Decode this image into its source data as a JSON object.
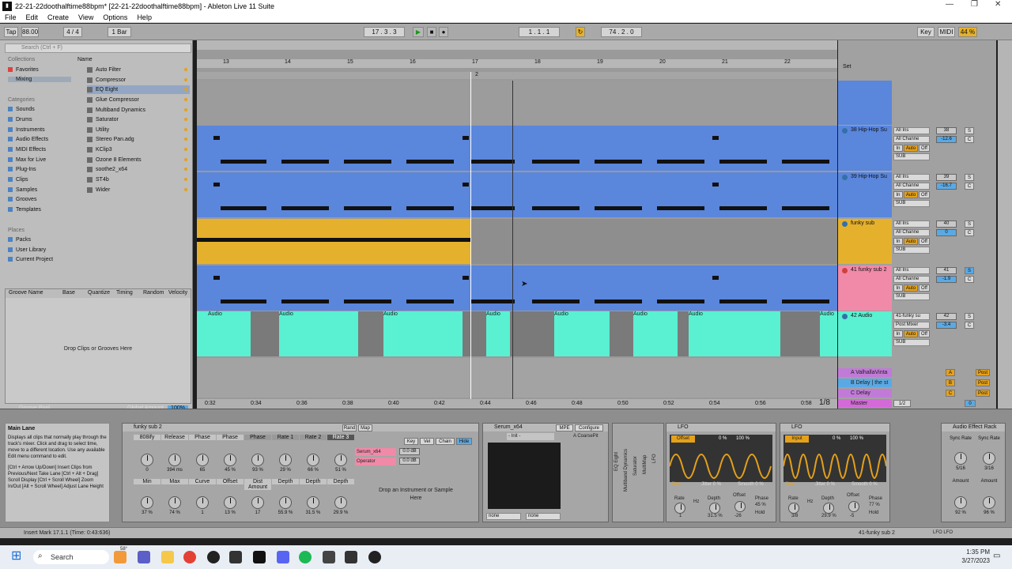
{
  "window": {
    "title": "22-21-22doothalftime88bpm* [22-21-22doothalftime88bpm] - Ableton Live 11 Suite"
  },
  "menu": [
    "File",
    "Edit",
    "Create",
    "View",
    "Options",
    "Help"
  ],
  "control": {
    "tap": "Tap",
    "tempo": "88.00",
    "sig": "4 / 4",
    "quant": "1 Bar",
    "pos": "17 . 3 . 3",
    "loop_start": "1 . 1 . 1",
    "loop_len": "74 . 2 . 0",
    "key": "Key",
    "midi": "MIDI",
    "cpu": "44 %"
  },
  "browser": {
    "search_placeholder": "Search (Ctrl + F)",
    "collections_head": "Collections",
    "collections": [
      "Favorites",
      "Mixing"
    ],
    "categories_head": "Categories",
    "categories": [
      "Sounds",
      "Drums",
      "Instruments",
      "Audio Effects",
      "MIDI Effects",
      "Max for Live",
      "Plug-Ins",
      "Clips",
      "Samples",
      "Grooves",
      "Templates"
    ],
    "places_head": "Places",
    "places": [
      "Packs",
      "User Library",
      "Current Project"
    ],
    "name_head": "Name",
    "items": [
      "Auto Filter",
      "Compressor",
      "EQ Eight",
      "Glue Compressor",
      "Multiband Dynamics",
      "Saturator",
      "Utility",
      "Stereo Pan.adg",
      "KClip3",
      "Ozone 8 Elements",
      "soothe2_x64",
      "ST4b",
      "Wider"
    ]
  },
  "groove": {
    "cols": [
      "Groove Name",
      "Base",
      "Quantize",
      "Timing",
      "Random",
      "Velocity"
    ],
    "hint": "Drop Clips or Grooves Here",
    "pool": "Groove Pool",
    "global_label": "Global Amount",
    "global_value": "100%"
  },
  "ruler": {
    "bars": [
      "13",
      "14",
      "15",
      "16",
      "17",
      "18",
      "19",
      "20",
      "21",
      "22"
    ],
    "times": [
      "0:32",
      "0:34",
      "0:36",
      "0:38",
      "0:40",
      "0:42",
      "0:44",
      "0:46",
      "0:48",
      "0:50",
      "0:52",
      "0:54",
      "0:56",
      "0:58"
    ],
    "loop_marker": "2",
    "set": "Set",
    "zoom": "1/8"
  },
  "tracks": [
    {
      "name": "38 Hip-Hop Su",
      "input": "All Ins",
      "chan": "All Channe",
      "out": "SUB",
      "num": "38",
      "vol": "-12.6",
      "pan": "C",
      "color": "#5a86dc"
    },
    {
      "name": "39 Hip-Hop Su",
      "input": "All Ins",
      "chan": "All Channe",
      "out": "SUB",
      "num": "39",
      "vol": "-16.7",
      "pan": "C",
      "color": "#5a86dc"
    },
    {
      "name": "funky sub",
      "input": "All Ins",
      "chan": "All Channe",
      "out": "SUB",
      "num": "40",
      "vol": "0",
      "pan": "C",
      "color": "#e5b12c"
    },
    {
      "name": "41 funky sub 2",
      "input": "All Ins",
      "chan": "All Channe",
      "out": "SUB",
      "num": "41",
      "vol": "-1.9",
      "pan": "C",
      "color": "#f08aa8"
    },
    {
      "name": "42 Audio",
      "input": "41-funky su",
      "chan": "Post Mixer",
      "out": "SUB",
      "num": "42",
      "vol": "-3.4",
      "pan": "C",
      "color": "#5af0d2"
    }
  ],
  "returns": [
    {
      "name": "A ValhallaVinta",
      "send": "A",
      "out": "Post"
    },
    {
      "name": "B Delay | the st",
      "send": "B",
      "out": "Post"
    },
    {
      "name": "C Delay",
      "send": "C",
      "out": "Post"
    },
    {
      "name": "Master",
      "send": "1/2",
      "out": "0"
    }
  ],
  "audio_clip_label": "Audio",
  "info": {
    "title": "Main Lane",
    "body": "Displays all clips that normally play through the track's mixer. Click and drag to select time, move to a different location. Use any available Edit menu command to edit.",
    "shortcuts": "[Ctrl + Arrow Up/Down] Insert Clips from Previous/Next Take Lane [Ctrl + Alt + Drag] Scroll Display [Ctrl + Scroll Wheel] Zoom In/Out [Alt + Scroll Wheel] Adjust Lane Height"
  },
  "rack": {
    "name": "funky sub 2",
    "tabs": [
      "808ify",
      "Release",
      "Phase",
      "Phase",
      "Phase",
      "Rate 1",
      "Rate 2",
      "Rate 3"
    ],
    "row1": [
      "0",
      "394 ms",
      "65",
      "45 %",
      "93 %",
      "29 %",
      "66 %",
      "51 %"
    ],
    "labels2": [
      "Min",
      "Max",
      "Curve",
      "Offset",
      "Dist Amount",
      "Depth",
      "Depth",
      "Depth"
    ],
    "row2": [
      "37 %",
      "74 %",
      "1",
      "13 %",
      "17",
      "55.9 %",
      "31.5 %",
      "29.9 %"
    ],
    "chain": {
      "rand": "Rand",
      "map": "Map",
      "key": "Key",
      "vel": "Vel",
      "chain": "Chain",
      "hide": "Hide",
      "c1": "Serum_x64",
      "c2": "Operator",
      "v1": "0.0 dB",
      "v2": "0.0 dB",
      "drop": "Drop an Instrument or Sample Here"
    }
  },
  "serum": {
    "name": "Serum_x64",
    "mpe": "MPE",
    "config": "Configure",
    "preset": "A CoarsePit",
    "init": "- Init -",
    "none1": "none",
    "none2": "none"
  },
  "fxlist": [
    "EQ Eight",
    "Multiband Dynamics",
    "Saturator",
    "MultiMap",
    "LFO"
  ],
  "lfo1": {
    "name": "LFO",
    "mode": "Offset",
    "p1": "0 %",
    "p2": "100 %",
    "wave": "Sine",
    "jitter": "Jitter 0 %",
    "smooth": "Smooth 0 %",
    "rate": "Rate",
    "rate_v": "1",
    "depth": "Depth",
    "depth_v": "31.5 %",
    "offset": "Offset",
    "offset_v": "-26",
    "phase": "Phase",
    "phase_v": "45 %",
    "hold": "Hold",
    "hz": "Hz"
  },
  "lfo2": {
    "name": "LFO",
    "mode": "Input",
    "p1": "0 %",
    "p2": "100 %",
    "wave": "Sine",
    "jitter": "Jitter 0 %",
    "smooth": "Smooth 0 %",
    "rate": "Rate",
    "rate_v": "3/8",
    "depth": "Depth",
    "depth_v": "29.9 %",
    "offset": "Offset",
    "offset_v": "-5",
    "phase": "Phase",
    "phase_v": "77 %",
    "hold": "Hold",
    "hz": "Hz"
  },
  "aerack": {
    "name": "Audio Effect Rack",
    "k": [
      "Sync Rate",
      "Sync Rate",
      "Amount",
      "Amount"
    ],
    "v": [
      "5/16",
      "3/16",
      "92 %",
      "96 %"
    ]
  },
  "status": {
    "text": "Insert Mark 17.1.1 (Time: 0:43:636)",
    "track": "41-funky sub 2",
    "lfo": "LFO LFO"
  },
  "taskbar": {
    "search": "Search",
    "time": "1:35 PM",
    "date": "3/27/2023",
    "weather": "58°"
  }
}
